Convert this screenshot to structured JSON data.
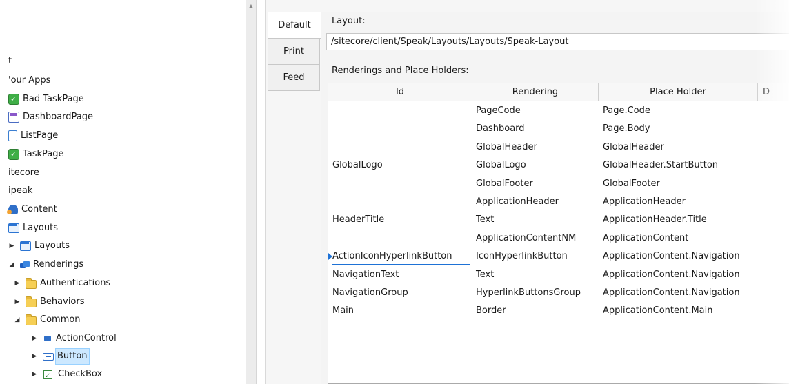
{
  "tree": {
    "items": [
      {
        "label": "t",
        "icon": "none",
        "expander": ""
      },
      {
        "label": "'our Apps",
        "icon": "none",
        "expander": ""
      },
      {
        "label": "Bad TaskPage",
        "icon": "task-page-icon",
        "expander": ""
      },
      {
        "label": "DashboardPage",
        "icon": "dashboard-page-icon",
        "expander": ""
      },
      {
        "label": "ListPage",
        "icon": "list-page-icon",
        "expander": ""
      },
      {
        "label": "TaskPage",
        "icon": "task-page-icon",
        "expander": ""
      },
      {
        "label": "itecore",
        "icon": "none",
        "expander": ""
      },
      {
        "label": "ipeak",
        "icon": "none",
        "expander": ""
      },
      {
        "label": "Content",
        "icon": "content-icon",
        "expander": ""
      },
      {
        "label": "Layouts",
        "icon": "layouts-folder-icon",
        "expander": ""
      },
      {
        "label": "Layouts",
        "icon": "layouts-folder-icon",
        "expander": "collapsed"
      },
      {
        "label": "Renderings",
        "icon": "renderings-icon",
        "expander": "expanded"
      },
      {
        "label": "Authentications",
        "icon": "folder-icon",
        "expander": "collapsed"
      },
      {
        "label": "Behaviors",
        "icon": "folder-icon",
        "expander": "collapsed"
      },
      {
        "label": "Common",
        "icon": "folder-icon",
        "expander": "expanded"
      },
      {
        "label": "ActionControl",
        "icon": "action-control-icon",
        "expander": "collapsed"
      },
      {
        "label": "Button",
        "icon": "button-icon",
        "expander": "collapsed",
        "selected": true
      },
      {
        "label": "CheckBox",
        "icon": "checkbox-icon",
        "expander": "collapsed"
      }
    ]
  },
  "tabs": [
    {
      "label": "Default",
      "active": true
    },
    {
      "label": "Print",
      "active": false
    },
    {
      "label": "Feed",
      "active": false
    }
  ],
  "layout": {
    "label": "Layout:",
    "path": "/sitecore/client/Speak/Layouts/Layouts/Speak-Layout"
  },
  "renderings": {
    "label": "Renderings and Place Holders:",
    "columns": [
      "Id",
      "Rendering",
      "Place Holder",
      "D"
    ],
    "rows": [
      {
        "id": "",
        "rendering": "PageCode",
        "placeholder": "Page.Code"
      },
      {
        "id": "",
        "rendering": "Dashboard",
        "placeholder": "Page.Body"
      },
      {
        "id": "",
        "rendering": "GlobalHeader",
        "placeholder": "GlobalHeader"
      },
      {
        "id": "GlobalLogo",
        "rendering": "GlobalLogo",
        "placeholder": "GlobalHeader.StartButton"
      },
      {
        "id": "",
        "rendering": "GlobalFooter",
        "placeholder": "GlobalFooter"
      },
      {
        "id": "",
        "rendering": "ApplicationHeader",
        "placeholder": "ApplicationHeader"
      },
      {
        "id": "HeaderTitle",
        "rendering": "Text",
        "placeholder": "ApplicationHeader.Title"
      },
      {
        "id": "",
        "rendering": "ApplicationContentNM",
        "placeholder": "ApplicationContent"
      },
      {
        "id": "ActionIconHyperlinkButton",
        "rendering": "IconHyperlinkButton",
        "placeholder": "ApplicationContent.Navigation",
        "current": true
      },
      {
        "id": "NavigationText",
        "rendering": "Text",
        "placeholder": "ApplicationContent.Navigation"
      },
      {
        "id": "NavigationGroup",
        "rendering": "HyperlinkButtonsGroup",
        "placeholder": "ApplicationContent.Navigation"
      },
      {
        "id": "Main",
        "rendering": "Border",
        "placeholder": "ApplicationContent.Main"
      }
    ]
  }
}
